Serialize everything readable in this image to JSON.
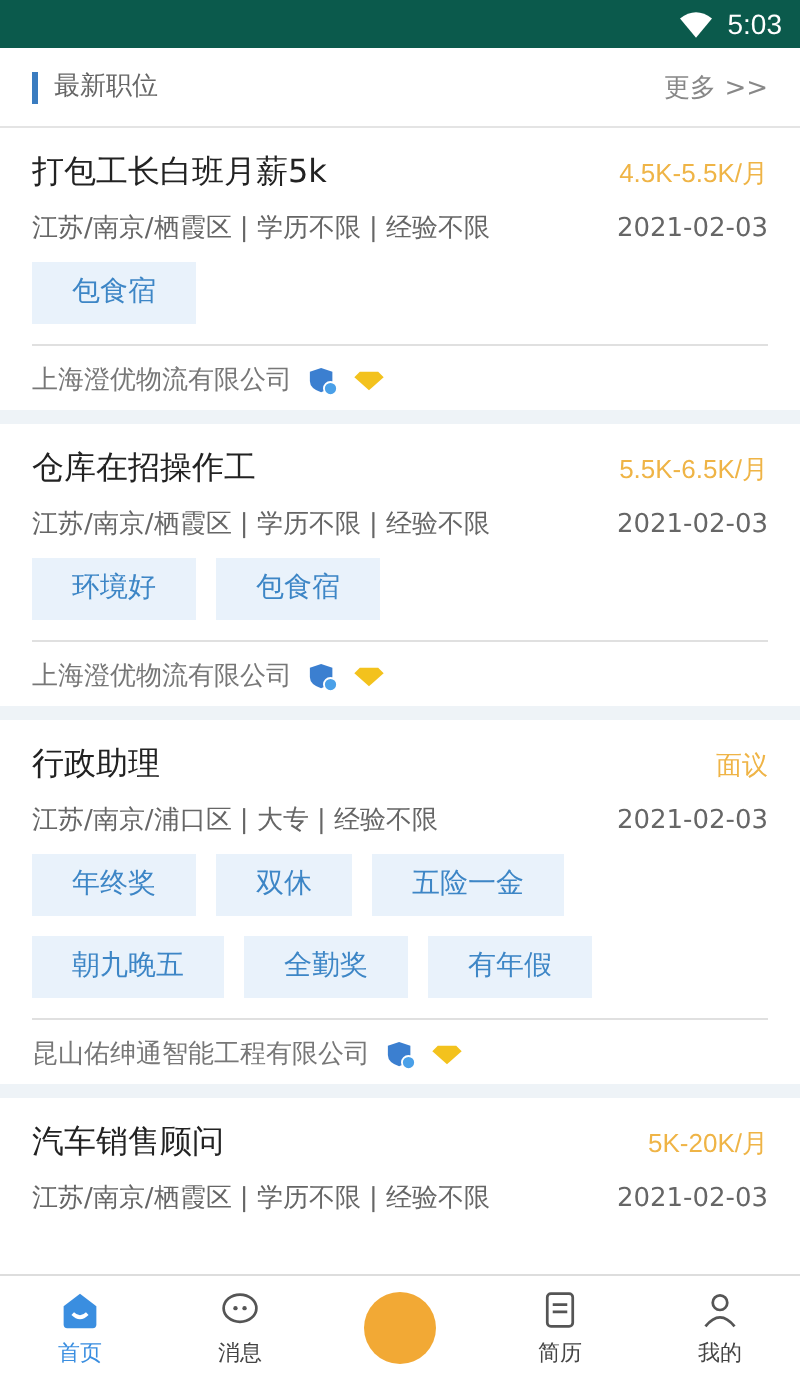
{
  "status_bar": {
    "time": "5:03"
  },
  "section": {
    "title": "最新职位",
    "more": "更多 >>"
  },
  "jobs": [
    {
      "title": "打包工长白班月薪5k",
      "salary": "4.5K-5.5K/月",
      "meta": "江苏/南京/栖霞区 | 学历不限 | 经验不限",
      "date": "2021-02-03",
      "tags": [
        "包食宿"
      ],
      "company": "上海澄优物流有限公司"
    },
    {
      "title": "仓库在招操作工",
      "salary": "5.5K-6.5K/月",
      "meta": "江苏/南京/栖霞区 | 学历不限 | 经验不限",
      "date": "2021-02-03",
      "tags": [
        "环境好",
        "包食宿"
      ],
      "company": "上海澄优物流有限公司"
    },
    {
      "title": "行政助理",
      "salary": "面议",
      "meta": "江苏/南京/浦口区 | 大专 | 经验不限",
      "date": "2021-02-03",
      "tags": [
        "年终奖",
        "双休",
        "五险一金",
        "朝九晚五",
        "全勤奖",
        "有年假"
      ],
      "company": "昆山佑绅通智能工程有限公司"
    },
    {
      "title": "汽车销售顾问",
      "salary": "5K-20K/月",
      "meta": "江苏/南京/栖霞区 | 学历不限 | 经验不限",
      "date": "2021-02-03"
    }
  ],
  "nav": [
    {
      "kind": "home",
      "label": "首页",
      "selected": true
    },
    {
      "kind": "chat",
      "label": "消息",
      "selected": false
    },
    {
      "kind": "publish",
      "selected": false
    },
    {
      "kind": "resume",
      "label": "简历",
      "selected": false
    },
    {
      "kind": "mine",
      "label": "我的",
      "selected": false
    }
  ]
}
